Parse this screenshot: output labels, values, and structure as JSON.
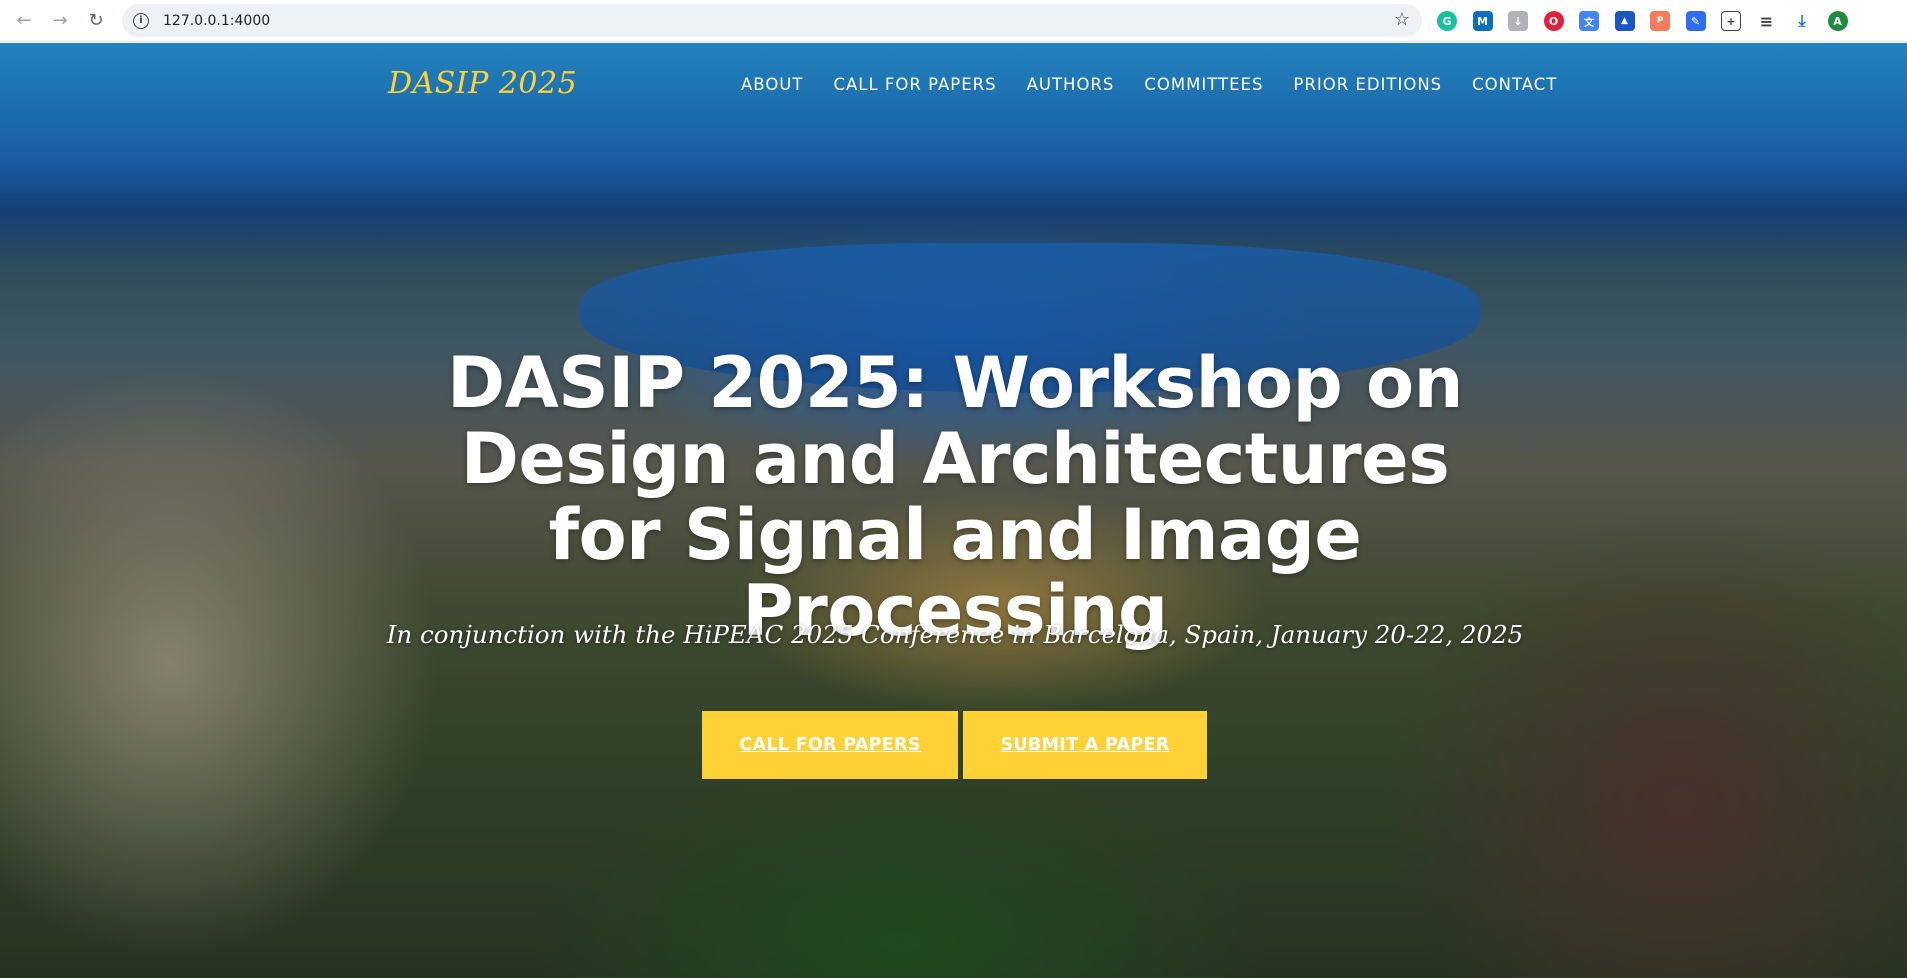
{
  "browser": {
    "url": "127.0.0.1:4000",
    "profile_initial": "A",
    "extensions": [
      {
        "icon": "grammarly-icon",
        "glyph": "G",
        "color": "#15c39a"
      },
      {
        "icon": "m-icon",
        "glyph": "M",
        "color": "#1a73e8"
      },
      {
        "icon": "download-box-icon",
        "glyph": "↓",
        "color": "#9aa0a6"
      },
      {
        "icon": "opera-icon",
        "glyph": "O",
        "color": "#e0203a"
      },
      {
        "icon": "translate-icon",
        "glyph": "文",
        "color": "#4285f4"
      },
      {
        "icon": "graduation-icon",
        "glyph": "▲",
        "color": "#1a56c8"
      },
      {
        "icon": "pdf-icon",
        "glyph": "P",
        "color": "#f47c5a"
      },
      {
        "icon": "pen-icon",
        "glyph": "✎",
        "color": "#2f6ef2"
      },
      {
        "icon": "puzzle-icon",
        "glyph": "⧉",
        "color": "#5f6368"
      },
      {
        "icon": "reading-list-icon",
        "glyph": "≡",
        "color": "#5f6368"
      },
      {
        "icon": "downloads-icon",
        "glyph": "⤓",
        "color": "#1a73e8"
      }
    ]
  },
  "site": {
    "brand": "DASIP 2025",
    "nav": [
      "ABOUT",
      "CALL FOR PAPERS",
      "AUTHORS",
      "COMMITTEES",
      "PRIOR EDITIONS",
      "CONTACT"
    ]
  },
  "hero": {
    "title": "DASIP 2025: Workshop on Design and Architectures for Signal and Image Processing",
    "subtitle": "In conjunction with the HiPEAC 2025 Conference in Barcelona, Spain, January 20-22, 2025",
    "buttons": [
      "CALL FOR PAPERS",
      "SUBMIT A PAPER"
    ]
  },
  "colors": {
    "accent": "#fed136",
    "text_light": "#ffffff"
  }
}
